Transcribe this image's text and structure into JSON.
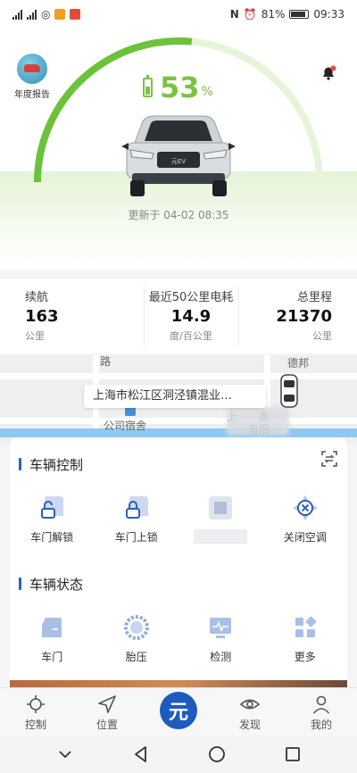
{
  "status_bar": {
    "left": [
      "4G",
      "4G"
    ],
    "battery_percent": "81%",
    "time": "09:33"
  },
  "hero": {
    "annual_report_label": "年度报告",
    "battery_level": 53,
    "battery_value": "53",
    "battery_unit": "%",
    "car_badge": "元EV",
    "updated_at": "更新于 04-02 08:35",
    "accent_color": "#6cc23a"
  },
  "stats": [
    {
      "title": "续航",
      "value": "163",
      "unit": "公里"
    },
    {
      "title": "最近50公里电耗",
      "value": "14.9",
      "unit": "度/百公里"
    },
    {
      "title": "总里程",
      "value": "21370",
      "unit": "公里"
    }
  ],
  "map": {
    "address": "上海市松江区洞泾镇混业…",
    "labels": {
      "road": "路",
      "debang": "德邦",
      "dorm": "公司宿舍",
      "shang": "上",
      "mei": "美",
      "youxian": "有限"
    }
  },
  "vehicle_control": {
    "title": "车辆控制",
    "items": [
      {
        "label": "车门解锁",
        "icon": "door-unlock-icon"
      },
      {
        "label": "车门上锁",
        "icon": "door-lock-icon"
      },
      {
        "label": "",
        "icon": "blurred-icon"
      },
      {
        "label": "关闭空调",
        "icon": "ac-off-icon"
      }
    ]
  },
  "vehicle_status": {
    "title": "车辆状态",
    "items": [
      {
        "label": "车门",
        "icon": "door-icon"
      },
      {
        "label": "胎压",
        "icon": "tire-icon"
      },
      {
        "label": "检测",
        "icon": "diagnostics-icon"
      },
      {
        "label": "更多",
        "icon": "more-icon"
      }
    ]
  },
  "tabbar": {
    "items": [
      {
        "label": "控制",
        "icon": "control-icon"
      },
      {
        "label": "位置",
        "icon": "location-icon"
      },
      {
        "label": "元",
        "icon": "yuan-brand-icon"
      },
      {
        "label": "发现",
        "icon": "discover-icon"
      },
      {
        "label": "我的",
        "icon": "profile-icon"
      }
    ]
  },
  "colors": {
    "primary": "#2c5fbf",
    "gauge_green": "#6cc23a",
    "tab_center": "#1f5bbd"
  }
}
